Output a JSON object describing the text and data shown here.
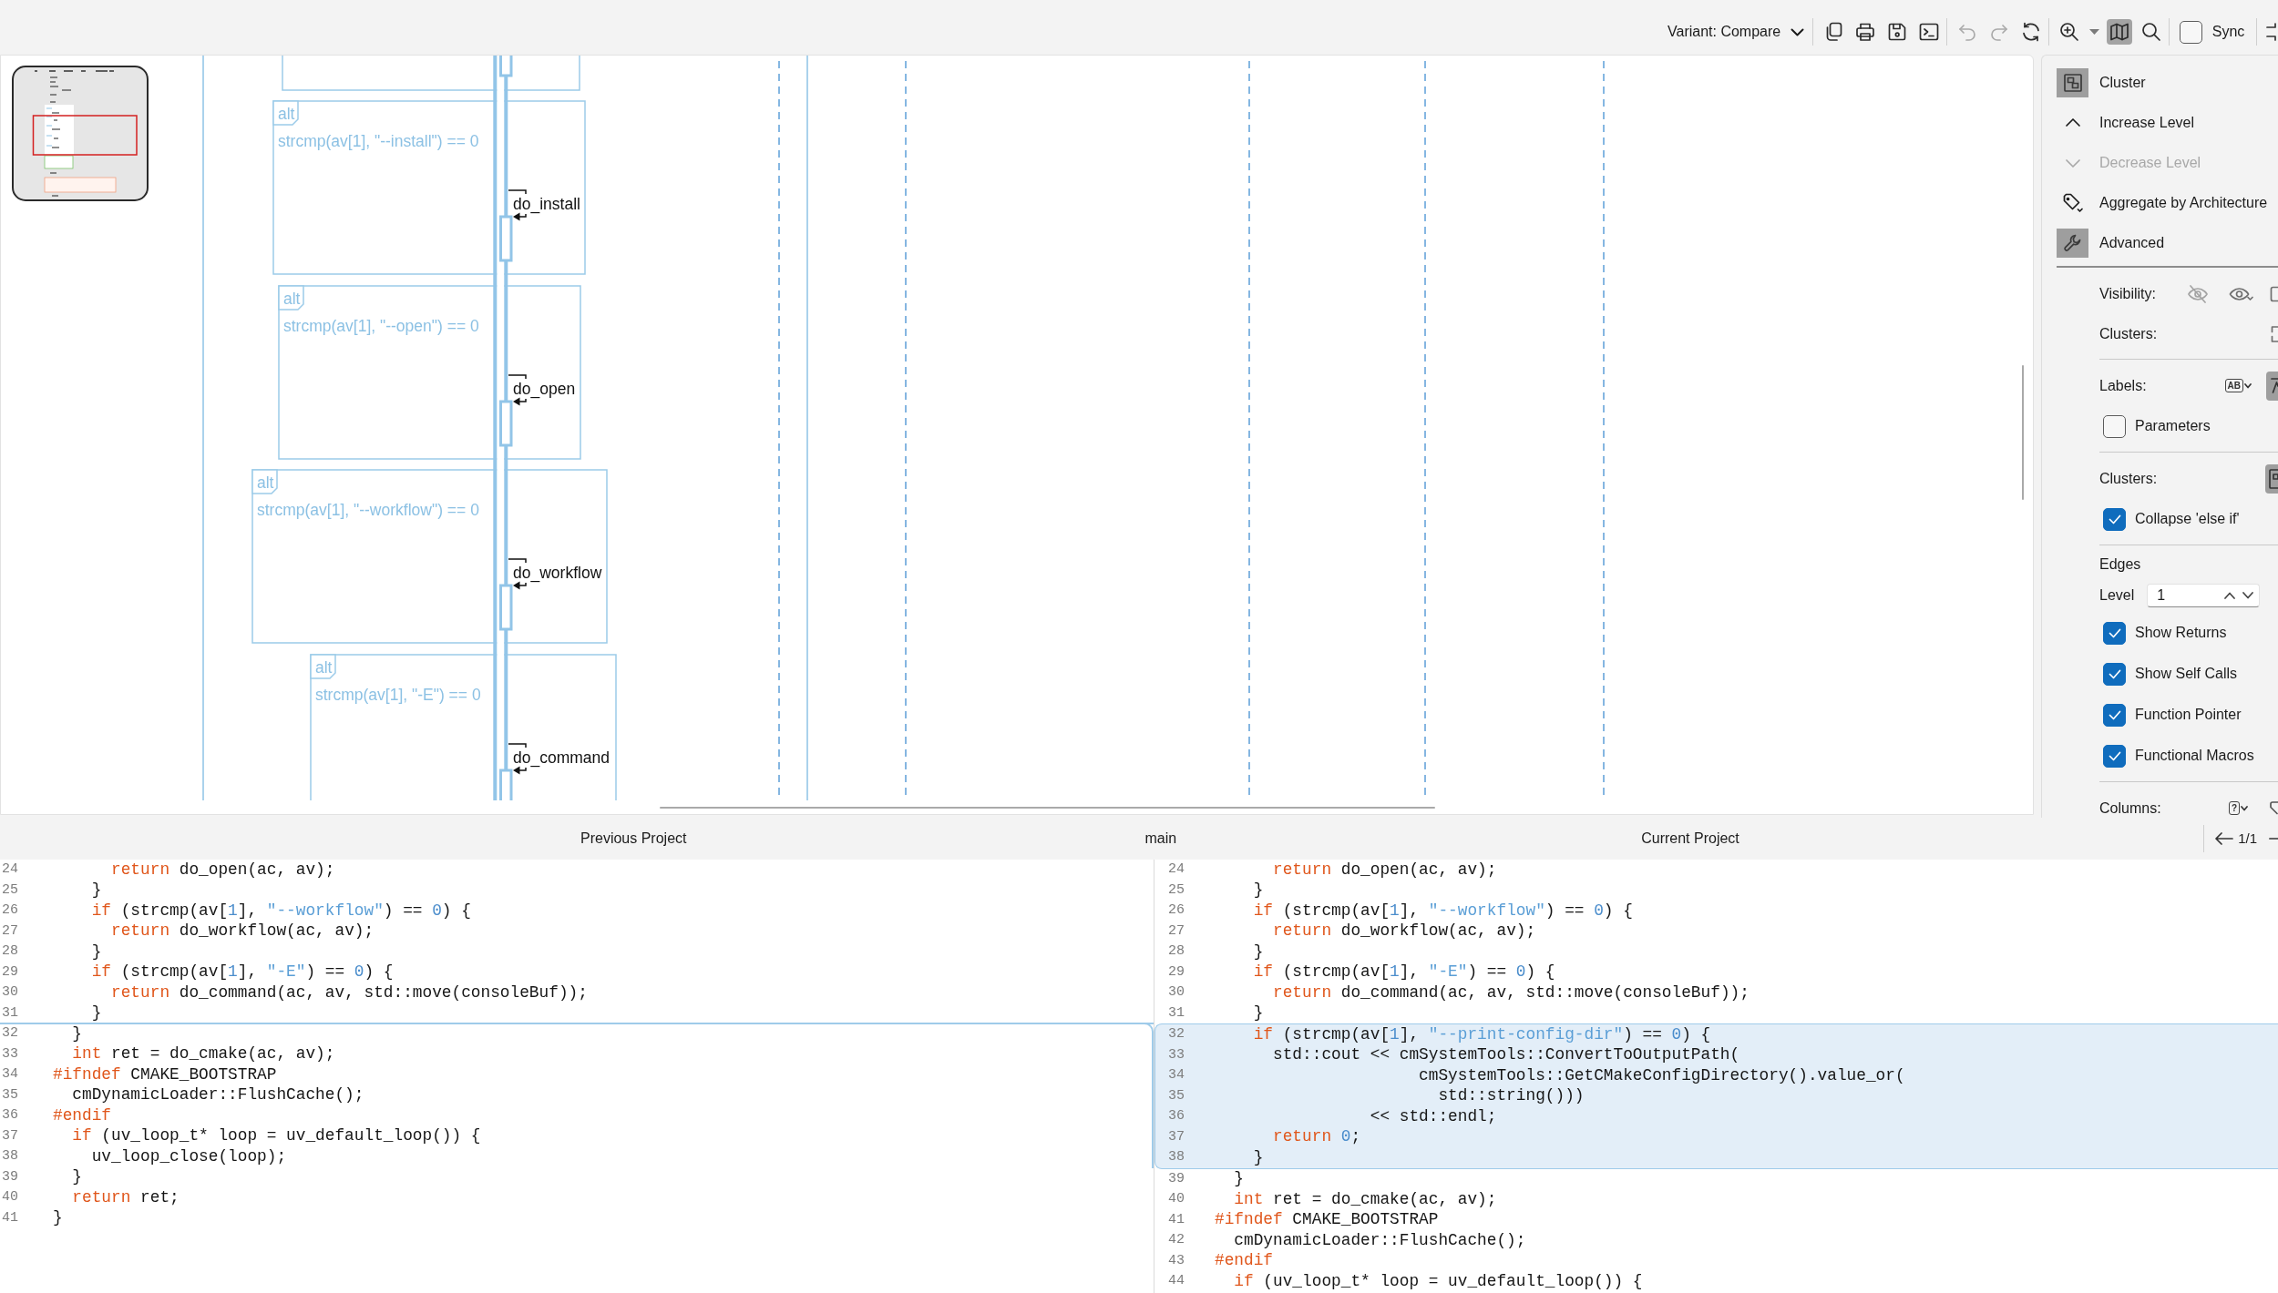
{
  "toolbar": {
    "variant": {
      "label": "Variant:",
      "value": "Compare"
    },
    "groups": [
      [
        {
          "kind": "copy",
          "disabled": false,
          "pressed": false
        },
        {
          "kind": "print",
          "disabled": false,
          "pressed": false
        },
        {
          "kind": "save",
          "disabled": false,
          "pressed": false
        },
        {
          "kind": "console",
          "disabled": false,
          "pressed": false
        }
      ],
      [
        {
          "kind": "undo",
          "disabled": true,
          "pressed": false
        },
        {
          "kind": "redo",
          "disabled": true,
          "pressed": false
        },
        {
          "kind": "reload",
          "disabled": false,
          "pressed": false
        }
      ],
      [
        {
          "kind": "zoom",
          "disabled": false,
          "pressed": false
        },
        {
          "kind": "map",
          "disabled": false,
          "pressed": true
        },
        {
          "kind": "find",
          "disabled": false,
          "pressed": false
        }
      ]
    ],
    "sync": {
      "label": "Sync",
      "checked": false
    }
  },
  "diagram": {
    "fragments": [
      {
        "operator": "alt",
        "condition": "strcmp(av[1], \"--install\") == 0",
        "call": "do_install"
      },
      {
        "operator": "alt",
        "condition": "strcmp(av[1], \"--open\") == 0",
        "call": "do_open"
      },
      {
        "operator": "alt",
        "condition": "strcmp(av[1], \"--workflow\") == 0",
        "call": "do_workflow"
      },
      {
        "operator": "alt",
        "condition": "strcmp(av[1], \"-E\") == 0",
        "call": "do_command"
      }
    ]
  },
  "side_panel": {
    "actions": [
      {
        "kind": "cluster",
        "label": "Cluster",
        "active": true,
        "disabled": false
      },
      {
        "kind": "increase",
        "label": "Increase Level",
        "active": false,
        "disabled": false
      },
      {
        "kind": "decrease",
        "label": "Decrease Level",
        "active": false,
        "disabled": true
      },
      {
        "kind": "aggregate",
        "label": "Aggregate by Architecture",
        "active": false,
        "disabled": false
      },
      {
        "kind": "advanced",
        "label": "Advanced",
        "active": true,
        "disabled": false
      }
    ],
    "sections": [
      {
        "rows": [
          {
            "kind": "tools",
            "label": "Visibility:",
            "buttons": [
              {
                "pressed": false
              },
              {
                "pressed": false
              },
              {
                "pressed": false
              }
            ]
          },
          {
            "kind": "tools",
            "label": "Clusters:",
            "buttons": [
              {
                "pressed": false
              }
            ]
          }
        ]
      },
      {
        "rows": [
          {
            "kind": "tools",
            "label": "Labels:",
            "buttons": [
              {
                "pressed": false,
                "glyph": "AB"
              },
              {
                "pressed": true
              }
            ]
          },
          {
            "kind": "checkbox",
            "label": "Parameters",
            "checked": false
          }
        ]
      },
      {
        "rows": [
          {
            "kind": "tools",
            "label": "Clusters:",
            "buttons": [
              {
                "pressed": true
              }
            ]
          },
          {
            "kind": "checkbox",
            "label": "Collapse 'else if'",
            "checked": true
          }
        ]
      },
      {
        "rows": [
          {
            "kind": "heading",
            "label": "Edges"
          },
          {
            "kind": "stepper",
            "label": "Level",
            "value": "1"
          },
          {
            "kind": "checkbox",
            "label": "Show Returns",
            "checked": true
          },
          {
            "kind": "checkbox",
            "label": "Show Self Calls",
            "checked": true
          },
          {
            "kind": "checkbox",
            "label": "Function Pointer",
            "checked": true
          },
          {
            "kind": "checkbox",
            "label": "Functional Macros",
            "checked": true
          }
        ]
      },
      {
        "rows": [
          {
            "kind": "tools",
            "label": "Columns:",
            "buttons": [
              {
                "pressed": false,
                "glyph": "?"
              },
              {
                "pressed": false
              }
            ]
          }
        ]
      }
    ]
  },
  "compare": {
    "header": {
      "previous_label": "Previous Project",
      "center_label": "main",
      "current_label": "Current Project",
      "hunk_counter": "1/1"
    },
    "panes": [
      {
        "hunks": [
          {
            "kind": "context",
            "lines": [
              {
                "number": "24",
                "tokens": [
                  {
                    "kind": "keyword",
                    "text": "      return"
                  },
                  {
                    "kind": "plain",
                    "text": " do_open(ac, av);"
                  }
                ]
              },
              {
                "number": "25",
                "tokens": [
                  {
                    "kind": "plain",
                    "text": "    }"
                  }
                ]
              },
              {
                "number": "26",
                "tokens": [
                  {
                    "kind": "keyword",
                    "text": "    if"
                  },
                  {
                    "kind": "plain",
                    "text": " (strcmp(av["
                  },
                  {
                    "kind": "number",
                    "text": "1"
                  },
                  {
                    "kind": "plain",
                    "text": "], "
                  },
                  {
                    "kind": "string",
                    "text": "\"--workflow\""
                  },
                  {
                    "kind": "plain",
                    "text": ") == "
                  },
                  {
                    "kind": "number",
                    "text": "0"
                  },
                  {
                    "kind": "plain",
                    "text": ") {"
                  }
                ]
              },
              {
                "number": "27",
                "tokens": [
                  {
                    "kind": "keyword",
                    "text": "      return"
                  },
                  {
                    "kind": "plain",
                    "text": " do_workflow(ac, av);"
                  }
                ]
              },
              {
                "number": "28",
                "tokens": [
                  {
                    "kind": "plain",
                    "text": "    }"
                  }
                ]
              },
              {
                "number": "29",
                "tokens": [
                  {
                    "kind": "keyword",
                    "text": "    if"
                  },
                  {
                    "kind": "plain",
                    "text": " (strcmp(av["
                  },
                  {
                    "kind": "number",
                    "text": "1"
                  },
                  {
                    "kind": "plain",
                    "text": "], "
                  },
                  {
                    "kind": "string",
                    "text": "\"-E\""
                  },
                  {
                    "kind": "plain",
                    "text": ") == "
                  },
                  {
                    "kind": "number",
                    "text": "0"
                  },
                  {
                    "kind": "plain",
                    "text": ") {"
                  }
                ]
              },
              {
                "number": "30",
                "tokens": [
                  {
                    "kind": "keyword",
                    "text": "      return"
                  },
                  {
                    "kind": "plain",
                    "text": " do_command(ac, av, std::move(consoleBuf));"
                  }
                ]
              },
              {
                "number": "31",
                "tokens": [
                  {
                    "kind": "plain",
                    "text": "    }"
                  }
                ]
              }
            ]
          },
          {
            "kind": "insertion"
          },
          {
            "kind": "context",
            "lines": [
              {
                "number": "32",
                "tokens": [
                  {
                    "kind": "plain",
                    "text": "  }"
                  }
                ]
              },
              {
                "number": "33",
                "tokens": [
                  {
                    "kind": "keyword",
                    "text": "  int"
                  },
                  {
                    "kind": "plain",
                    "text": " ret = do_cmake(ac, av);"
                  }
                ]
              },
              {
                "number": "34",
                "tokens": [
                  {
                    "kind": "keyword",
                    "text": "#ifndef"
                  },
                  {
                    "kind": "plain",
                    "text": " CMAKE_BOOTSTRAP"
                  }
                ]
              },
              {
                "number": "35",
                "tokens": [
                  {
                    "kind": "plain",
                    "text": "  cmDynamicLoader::FlushCache();"
                  }
                ]
              },
              {
                "number": "36",
                "tokens": [
                  {
                    "kind": "keyword",
                    "text": "#endif"
                  }
                ]
              },
              {
                "number": "37",
                "tokens": [
                  {
                    "kind": "keyword",
                    "text": "  if"
                  },
                  {
                    "kind": "plain",
                    "text": " (uv_loop_t* loop = uv_default_loop()) {"
                  }
                ]
              },
              {
                "number": "38",
                "tokens": [
                  {
                    "kind": "plain",
                    "text": "    uv_loop_close(loop);"
                  }
                ]
              },
              {
                "number": "39",
                "tokens": [
                  {
                    "kind": "plain",
                    "text": "  }"
                  }
                ]
              },
              {
                "number": "40",
                "tokens": [
                  {
                    "kind": "keyword",
                    "text": "  return"
                  },
                  {
                    "kind": "plain",
                    "text": " ret;"
                  }
                ]
              },
              {
                "number": "41",
                "tokens": [
                  {
                    "kind": "plain",
                    "text": "}"
                  }
                ]
              }
            ]
          }
        ]
      },
      {
        "hunks": [
          {
            "kind": "context",
            "lines": [
              {
                "number": "24",
                "tokens": [
                  {
                    "kind": "keyword",
                    "text": "      return"
                  },
                  {
                    "kind": "plain",
                    "text": " do_open(ac, av);"
                  }
                ]
              },
              {
                "number": "25",
                "tokens": [
                  {
                    "kind": "plain",
                    "text": "    }"
                  }
                ]
              },
              {
                "number": "26",
                "tokens": [
                  {
                    "kind": "keyword",
                    "text": "    if"
                  },
                  {
                    "kind": "plain",
                    "text": " (strcmp(av["
                  },
                  {
                    "kind": "number",
                    "text": "1"
                  },
                  {
                    "kind": "plain",
                    "text": "], "
                  },
                  {
                    "kind": "string",
                    "text": "\"--workflow\""
                  },
                  {
                    "kind": "plain",
                    "text": ") == "
                  },
                  {
                    "kind": "number",
                    "text": "0"
                  },
                  {
                    "kind": "plain",
                    "text": ") {"
                  }
                ]
              },
              {
                "number": "27",
                "tokens": [
                  {
                    "kind": "keyword",
                    "text": "      return"
                  },
                  {
                    "kind": "plain",
                    "text": " do_workflow(ac, av);"
                  }
                ]
              },
              {
                "number": "28",
                "tokens": [
                  {
                    "kind": "plain",
                    "text": "    }"
                  }
                ]
              },
              {
                "number": "29",
                "tokens": [
                  {
                    "kind": "keyword",
                    "text": "    if"
                  },
                  {
                    "kind": "plain",
                    "text": " (strcmp(av["
                  },
                  {
                    "kind": "number",
                    "text": "1"
                  },
                  {
                    "kind": "plain",
                    "text": "], "
                  },
                  {
                    "kind": "string",
                    "text": "\"-E\""
                  },
                  {
                    "kind": "plain",
                    "text": ") == "
                  },
                  {
                    "kind": "number",
                    "text": "0"
                  },
                  {
                    "kind": "plain",
                    "text": ") {"
                  }
                ]
              },
              {
                "number": "30",
                "tokens": [
                  {
                    "kind": "keyword",
                    "text": "      return"
                  },
                  {
                    "kind": "plain",
                    "text": " do_command(ac, av, std::move(consoleBuf));"
                  }
                ]
              },
              {
                "number": "31",
                "tokens": [
                  {
                    "kind": "plain",
                    "text": "    }"
                  }
                ]
              }
            ]
          },
          {
            "kind": "added",
            "lines": [
              {
                "number": "32",
                "tokens": [
                  {
                    "kind": "keyword",
                    "text": "    if"
                  },
                  {
                    "kind": "plain",
                    "text": " (strcmp(av["
                  },
                  {
                    "kind": "number",
                    "text": "1"
                  },
                  {
                    "kind": "plain",
                    "text": "], "
                  },
                  {
                    "kind": "string",
                    "text": "\"--print-config-dir\""
                  },
                  {
                    "kind": "plain",
                    "text": ") == "
                  },
                  {
                    "kind": "number",
                    "text": "0"
                  },
                  {
                    "kind": "plain",
                    "text": ") {"
                  }
                ]
              },
              {
                "number": "33",
                "tokens": [
                  {
                    "kind": "plain",
                    "text": "      std::cout << cmSystemTools::ConvertToOutputPath("
                  }
                ]
              },
              {
                "number": "34",
                "tokens": [
                  {
                    "kind": "plain",
                    "text": "                     cmSystemTools::GetCMakeConfigDirectory().value_or("
                  }
                ]
              },
              {
                "number": "35",
                "tokens": [
                  {
                    "kind": "plain",
                    "text": "                       std::string()))"
                  }
                ]
              },
              {
                "number": "36",
                "tokens": [
                  {
                    "kind": "plain",
                    "text": "                << std::endl;"
                  }
                ]
              },
              {
                "number": "37",
                "tokens": [
                  {
                    "kind": "keyword",
                    "text": "      return "
                  },
                  {
                    "kind": "number",
                    "text": "0"
                  },
                  {
                    "kind": "plain",
                    "text": ";"
                  }
                ]
              },
              {
                "number": "38",
                "tokens": [
                  {
                    "kind": "plain",
                    "text": "    }"
                  }
                ]
              }
            ]
          },
          {
            "kind": "context",
            "lines": [
              {
                "number": "39",
                "tokens": [
                  {
                    "kind": "plain",
                    "text": "  }"
                  }
                ]
              },
              {
                "number": "40",
                "tokens": [
                  {
                    "kind": "keyword",
                    "text": "  int"
                  },
                  {
                    "kind": "plain",
                    "text": " ret = do_cmake(ac, av);"
                  }
                ]
              },
              {
                "number": "41",
                "tokens": [
                  {
                    "kind": "keyword",
                    "text": "#ifndef"
                  },
                  {
                    "kind": "plain",
                    "text": " CMAKE_BOOTSTRAP"
                  }
                ]
              },
              {
                "number": "42",
                "tokens": [
                  {
                    "kind": "plain",
                    "text": "  cmDynamicLoader::FlushCache();"
                  }
                ]
              },
              {
                "number": "43",
                "tokens": [
                  {
                    "kind": "keyword",
                    "text": "#endif"
                  }
                ]
              },
              {
                "number": "44",
                "tokens": [
                  {
                    "kind": "keyword",
                    "text": "  if"
                  },
                  {
                    "kind": "plain",
                    "text": " (uv_loop_t* loop = uv_default_loop()) {"
                  }
                ]
              }
            ]
          }
        ]
      }
    ]
  }
}
